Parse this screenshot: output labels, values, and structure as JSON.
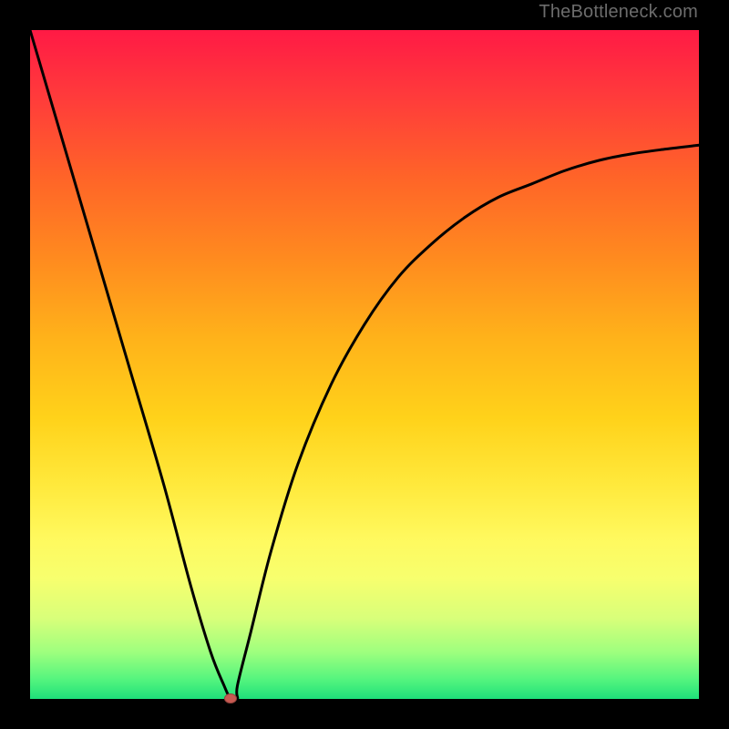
{
  "watermark": "TheBottleneck.com",
  "colors": {
    "frame": "#000000",
    "curve": "#000000",
    "marker": "#c85a52",
    "gradient_top": "#ff1a45",
    "gradient_bottom": "#1ee07a"
  },
  "chart_data": {
    "type": "line",
    "title": "",
    "xlabel": "",
    "ylabel": "",
    "xlim": [
      0,
      100
    ],
    "ylim": [
      0,
      100
    ],
    "grid": false,
    "legend": false,
    "annotations": [],
    "series": [
      {
        "name": "bottleneck-curve",
        "x": [
          0,
          5,
          10,
          15,
          20,
          24,
          27,
          29,
          30,
          31,
          31,
          33,
          36,
          40,
          45,
          50,
          55,
          60,
          65,
          70,
          75,
          80,
          85,
          90,
          95,
          100
        ],
        "y": [
          100,
          83,
          66,
          49,
          32,
          17,
          7,
          2,
          0,
          0,
          2,
          10,
          22,
          35,
          47,
          56,
          63,
          68,
          72,
          75,
          77,
          79,
          80.5,
          81.5,
          82.2,
          82.8
        ]
      }
    ],
    "marker": {
      "x": 30,
      "y": 0
    },
    "notes": "Axes are unlabeled in the source image; values are estimated on a 0–100 scale from pixel positions. The curve descends sharply from top-left to a minimum near x≈30, then rises with diminishing slope toward the right edge."
  }
}
